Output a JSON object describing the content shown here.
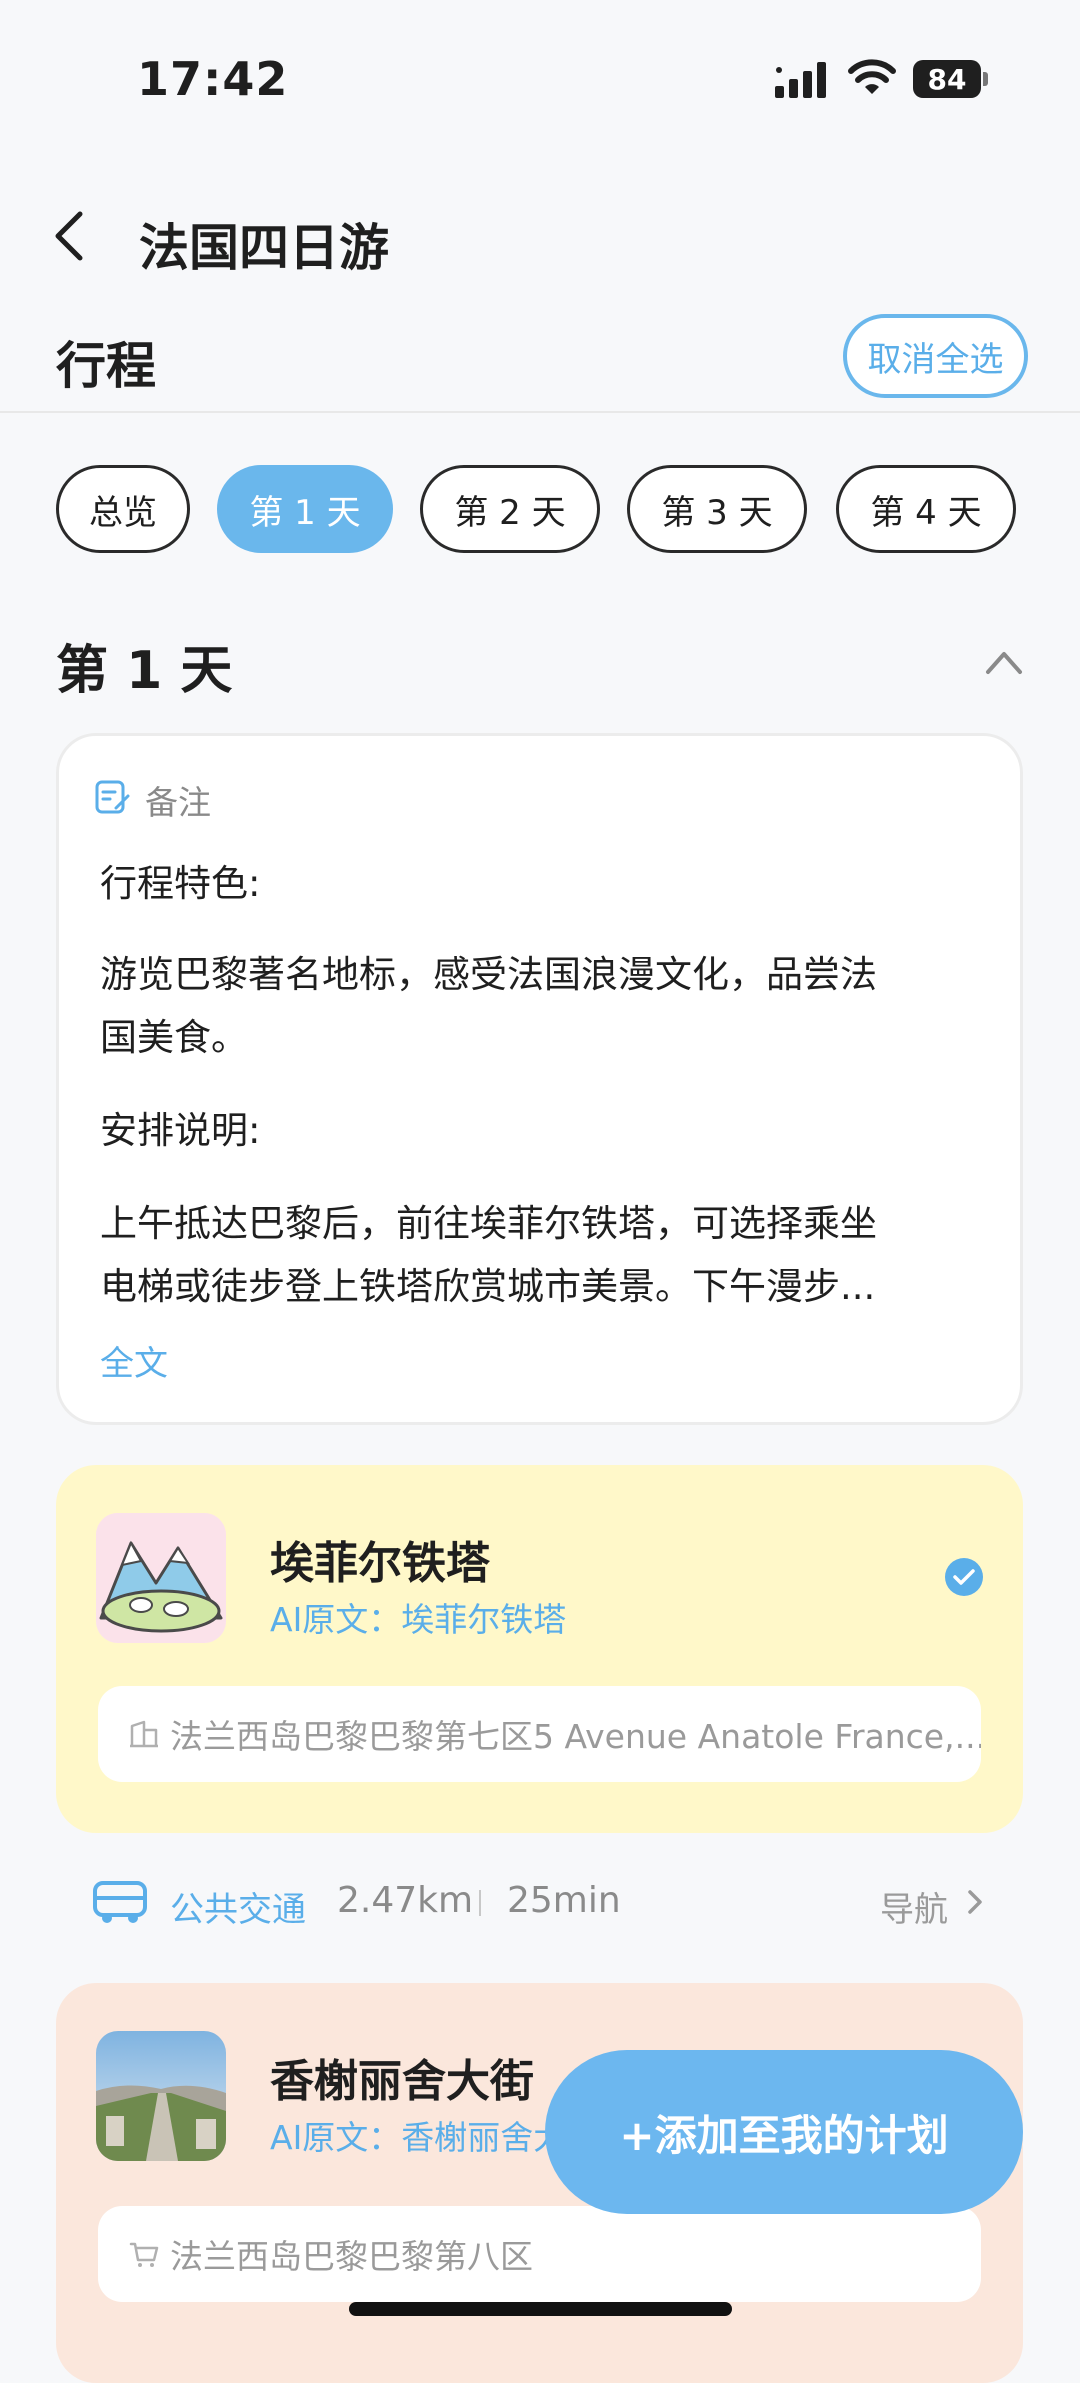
{
  "status_bar": {
    "time": "17:42",
    "battery": "84"
  },
  "header": {
    "title": "法国四日游"
  },
  "section": {
    "title": "行程",
    "cancel_select_label": "取消全选"
  },
  "tabs": [
    {
      "label": "总览",
      "active": false
    },
    {
      "label": "第 1 天",
      "active": true
    },
    {
      "label": "第 2 天",
      "active": false
    },
    {
      "label": "第 3 天",
      "active": false
    },
    {
      "label": "第 4 天",
      "active": false
    }
  ],
  "day": {
    "title": "第 1 天"
  },
  "note": {
    "label": "备注",
    "feature_heading": "行程特色:",
    "feature_line1": "游览巴黎著名地标，感受法国浪漫文化，品尝法",
    "feature_line2": "国美食。",
    "arrangement_heading": "安排说明:",
    "arrangement_line1": "上午抵达巴黎后，前往埃菲尔铁塔，可选择乘坐",
    "arrangement_line2": "电梯或徒步登上铁塔欣赏城市美景。下午漫步...",
    "full_text_link": "全文"
  },
  "pois": [
    {
      "name": "埃菲尔铁塔",
      "ai_source": "AI原文：埃菲尔铁塔",
      "address": "法兰西岛巴黎巴黎第七区5 Avenue Anatole France,...",
      "selected": true,
      "bg_color": "#fff8c9"
    },
    {
      "name": "香榭丽舍大街",
      "ai_source": "AI原文：香榭丽舍大街",
      "address": "法兰西岛巴黎巴黎第八区",
      "bg_color": "#fbe7dc"
    }
  ],
  "transport": {
    "mode": "公共交通",
    "distance": "2.47km",
    "duration": "25min",
    "nav_label": "导航"
  },
  "fab": {
    "label": "+添加至我的计划"
  },
  "colors": {
    "accent": "#6ab7ec",
    "text": "#1f1f1f",
    "muted": "#9a9a9a"
  }
}
